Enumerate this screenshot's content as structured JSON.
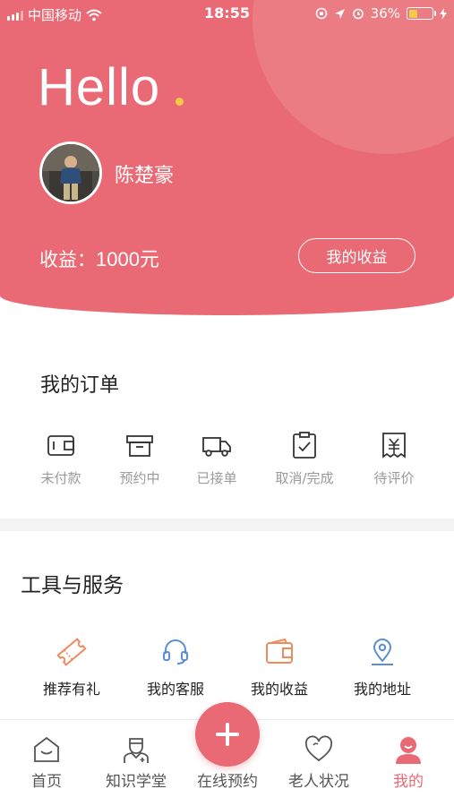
{
  "status_bar": {
    "carrier": "中国移动",
    "time": "18:55",
    "battery_percent": "36%",
    "battery_level": 0.36,
    "battery_color": "#f7c948"
  },
  "header": {
    "greeting": "Hello",
    "accent_color": "#e96a74",
    "dot_color": "#f7c948",
    "user_name": "陈楚豪",
    "earnings_label": "收益：",
    "earnings_value": "1000元",
    "earnings_button": "我的收益"
  },
  "orders": {
    "title": "我的订单",
    "items": [
      {
        "label": "未付款",
        "icon": "wallet-icon"
      },
      {
        "label": "预约中",
        "icon": "calendar-box-icon"
      },
      {
        "label": "已接单",
        "icon": "truck-icon"
      },
      {
        "label": "取消/完成",
        "icon": "clipboard-check-icon"
      },
      {
        "label": "待评价",
        "icon": "yen-receipt-icon"
      }
    ]
  },
  "tools": {
    "title": "工具与服务",
    "items": [
      {
        "label": "推荐有礼",
        "icon": "ticket-icon",
        "color": "#f08a5d"
      },
      {
        "label": "我的客服",
        "icon": "headset-icon",
        "color": "#5b8fd1"
      },
      {
        "label": "我的收益",
        "icon": "wallet-icon",
        "color": "#f08a5d"
      },
      {
        "label": "我的地址",
        "icon": "location-pin-icon",
        "color": "#5b8fd1"
      }
    ]
  },
  "tabbar": {
    "items": [
      {
        "label": "首页",
        "icon": "home-icon"
      },
      {
        "label": "知识学堂",
        "icon": "doctor-icon"
      },
      {
        "label": "在线预约",
        "icon": "plus-icon"
      },
      {
        "label": "老人状况",
        "icon": "heart-icon"
      },
      {
        "label": "我的",
        "icon": "profile-icon",
        "active": true
      }
    ],
    "active_color": "#e96a74"
  }
}
